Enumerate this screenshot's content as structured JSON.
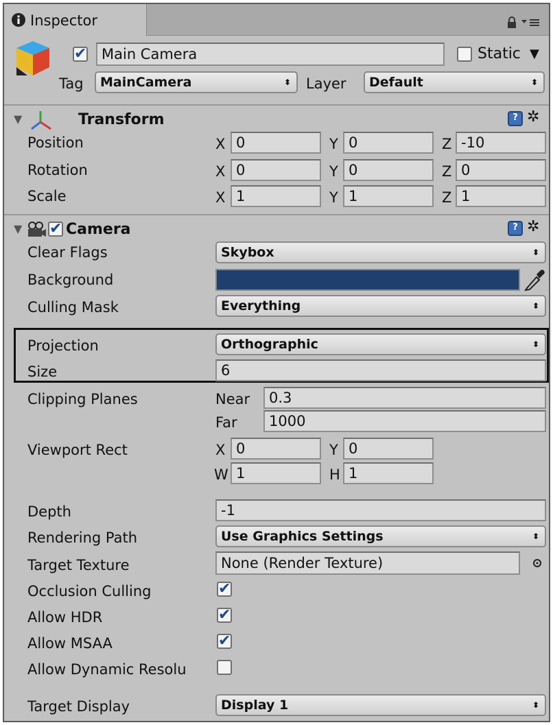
{
  "tab": {
    "title": "Inspector",
    "info_icon": "info-icon",
    "lock_icon": "lock-icon",
    "menu_icon": "tab-menu-icon"
  },
  "object": {
    "icon": "gameobject-cube-icon",
    "active": "✔",
    "name": "Main Camera",
    "static_label": "Static",
    "static_arrow": "▼",
    "tag_label": "Tag",
    "tag_value": "MainCamera",
    "layer_label": "Layer",
    "layer_value": "Default"
  },
  "popup_arrow": "⬍",
  "transform": {
    "title": "Transform",
    "rows": [
      {
        "label": "Position",
        "x": "0",
        "y": "0",
        "z": "-10"
      },
      {
        "label": "Rotation",
        "x": "0",
        "y": "0",
        "z": "0"
      },
      {
        "label": "Scale",
        "x": "1",
        "y": "1",
        "z": "1"
      }
    ],
    "axes": {
      "x": "X",
      "y": "Y",
      "z": "Z"
    }
  },
  "camera": {
    "title": "Camera",
    "enabled": "✔",
    "background_color": "#1f3f6e",
    "clear_flags": {
      "label": "Clear Flags",
      "value": "Skybox"
    },
    "background": {
      "label": "Background"
    },
    "culling_mask": {
      "label": "Culling Mask",
      "value": "Everything"
    },
    "projection": {
      "label": "Projection",
      "value": "Orthographic"
    },
    "size": {
      "label": "Size",
      "value": "6"
    },
    "clipping": {
      "label": "Clipping Planes",
      "near_label": "Near",
      "near": "0.3",
      "far_label": "Far",
      "far": "1000"
    },
    "viewport": {
      "label": "Viewport Rect",
      "x_label": "X",
      "x": "0",
      "y_label": "Y",
      "y": "0",
      "w_label": "W",
      "w": "1",
      "h_label": "H",
      "h": "1"
    },
    "depth": {
      "label": "Depth",
      "value": "-1"
    },
    "rendering_path": {
      "label": "Rendering Path",
      "value": "Use Graphics Settings"
    },
    "target_texture": {
      "label": "Target Texture",
      "value": "None (Render Texture)"
    },
    "occlusion_culling": {
      "label": "Occlusion Culling",
      "mark": "✔"
    },
    "allow_hdr": {
      "label": "Allow HDR",
      "mark": "✔"
    },
    "allow_msaa": {
      "label": "Allow MSAA",
      "mark": "✔"
    },
    "allow_dynamic": {
      "label": "Allow Dynamic Resolu",
      "mark": ""
    },
    "target_display": {
      "label": "Target Display",
      "value": "Display 1"
    }
  },
  "help_glyph": "?",
  "gear_glyph": "✲",
  "foldout_glyph": "▼"
}
